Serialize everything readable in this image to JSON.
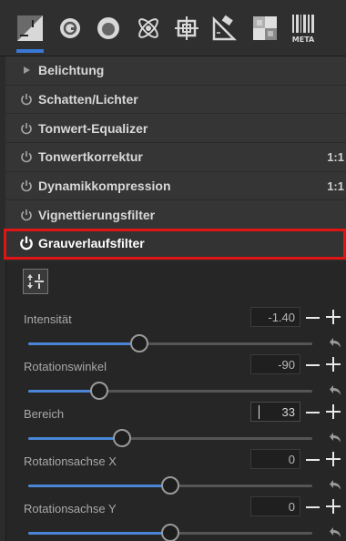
{
  "toolbar": {
    "tabs": [
      {
        "name": "exposure-tab-icon",
        "active": true
      },
      {
        "name": "detail-tab-icon"
      },
      {
        "name": "color-tab-icon"
      },
      {
        "name": "advanced-tab-icon"
      },
      {
        "name": "transform-tab-icon"
      },
      {
        "name": "raw-tab-icon"
      },
      {
        "name": "local-tab-icon"
      },
      {
        "name": "meta-tab-icon",
        "label": "META"
      }
    ],
    "accent": "#3a78d6"
  },
  "tools": [
    {
      "label": "Belichtung",
      "icon": "triangle-right-icon",
      "value": ""
    },
    {
      "label": "Schatten/Lichter",
      "icon": "power-icon",
      "value": ""
    },
    {
      "label": "Tonwert-Equalizer",
      "icon": "power-icon",
      "value": ""
    },
    {
      "label": "Tonwertkorrektur",
      "icon": "power-icon",
      "value": "1:1"
    },
    {
      "label": "Dynamikkompression",
      "icon": "power-icon",
      "value": "1:1"
    },
    {
      "label": "Vignettierungsfilter",
      "icon": "power-icon",
      "value": ""
    },
    {
      "label": "Grauverlaufsfilter",
      "icon": "power-icon",
      "value": "",
      "highlighted": true
    }
  ],
  "highlight_color": "#e01414",
  "params": [
    {
      "label": "Intensität",
      "value": "-1.40",
      "level": 0.39
    },
    {
      "label": "Rotationswinkel",
      "value": "-90",
      "level": 0.25
    },
    {
      "label": "Bereich",
      "value": "33",
      "level": 0.33,
      "editing": true
    },
    {
      "label": "Rotationsachse X",
      "value": "0",
      "level": 0.5
    },
    {
      "label": "Rotationsachse Y",
      "value": "0",
      "level": 0.5
    }
  ]
}
